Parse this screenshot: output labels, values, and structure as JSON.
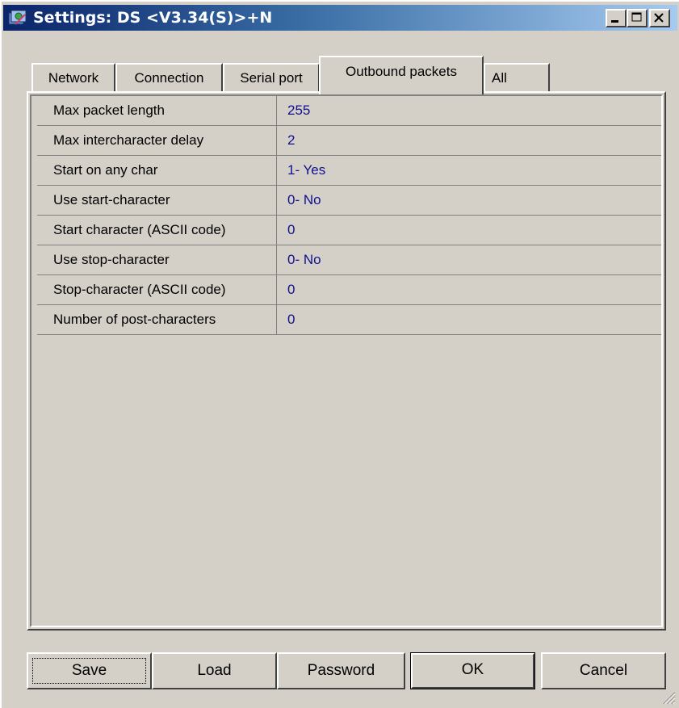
{
  "window": {
    "title": "Settings: DS <V3.34(S)>+N",
    "icon": "app-settings-icon"
  },
  "tabs": [
    {
      "label": "Network",
      "active": false
    },
    {
      "label": "Connection",
      "active": false
    },
    {
      "label": "Serial port",
      "active": false
    },
    {
      "label": "Outbound packets",
      "active": true
    },
    {
      "label": "All",
      "active": false
    }
  ],
  "settings": [
    {
      "name": "Max packet length",
      "value": "255"
    },
    {
      "name": "Max intercharacter delay",
      "value": "2"
    },
    {
      "name": "Start on any char",
      "value": "1- Yes"
    },
    {
      "name": "Use start-character",
      "value": "0- No"
    },
    {
      "name": "Start character (ASCII code)",
      "value": "0"
    },
    {
      "name": "Use stop-character",
      "value": "0- No"
    },
    {
      "name": "Stop-character (ASCII code)",
      "value": "0"
    },
    {
      "name": "Number of post-characters",
      "value": "0"
    }
  ],
  "buttons": {
    "save": "Save",
    "load": "Load",
    "password": "Password",
    "ok": "OK",
    "cancel": "Cancel"
  },
  "colors": {
    "face": "#d4d0c8",
    "title_start": "#0a246a",
    "title_end": "#a6caf0",
    "value_text": "#10108e"
  }
}
